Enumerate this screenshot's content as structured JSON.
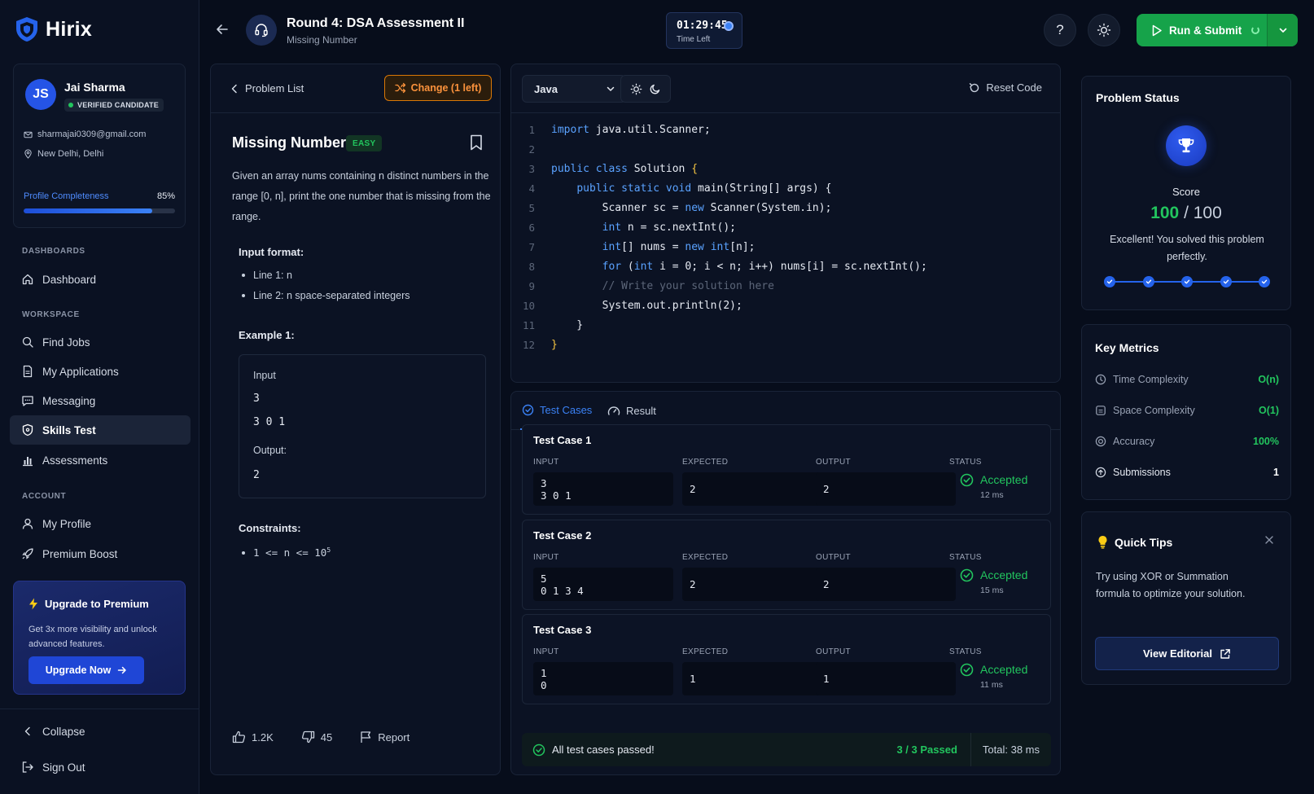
{
  "brand": {
    "name": "Hirix"
  },
  "profile": {
    "initials": "JS",
    "name": "Jai Sharma",
    "badge": "VERIFIED CANDIDATE",
    "email": "sharmajai0309@gmail.com",
    "location": "New Delhi, Delhi",
    "completeness_label": "Profile Completeness",
    "completeness_value": "85%",
    "completeness_fraction": 0.85
  },
  "nav": {
    "dashboards_label": "DASHBOARDS",
    "workspace_label": "WORKSPACE",
    "account_label": "ACCOUNT",
    "items": [
      {
        "label": "Dashboard",
        "icon": "home-icon"
      },
      {
        "label": "Find Jobs",
        "icon": "search-icon"
      },
      {
        "label": "My Applications",
        "icon": "document-icon"
      },
      {
        "label": "Messaging",
        "icon": "chat-icon"
      },
      {
        "label": "Skills Test",
        "icon": "shield-icon",
        "active": true
      },
      {
        "label": "Assessments",
        "icon": "bar-chart-icon"
      },
      {
        "label": "My Profile",
        "icon": "user-icon"
      },
      {
        "label": "Premium Boost",
        "icon": "rocket-icon"
      }
    ],
    "collapse": "Collapse",
    "sign_out": "Sign Out"
  },
  "promo": {
    "title": "Upgrade to Premium",
    "desc": "Get 3x more visibility and unlock advanced features.",
    "button": "Upgrade Now"
  },
  "header": {
    "title": "Round 4: DSA Assessment II",
    "subtitle": "Missing Number",
    "timer": "01:29:45",
    "timer_label": "Time Left",
    "help": "?",
    "run_submit": "Run & Submit"
  },
  "problem": {
    "back_label": "Problem List",
    "change_label": "Change (1 left)",
    "title": "Missing Number",
    "difficulty": "EASY",
    "description": "Given an array nums containing n distinct numbers in the range [0, n], print the one number that is missing from the range.",
    "input_format_heading": "Input format:",
    "input_format": [
      "Line 1: n",
      "Line 2: n space-separated integers"
    ],
    "example_heading": "Example 1:",
    "example": {
      "input_label": "Input",
      "input_line1": "3",
      "input_line2": "3 0 1",
      "output_label": "Output:",
      "output": "2"
    },
    "constraints_heading": "Constraints:",
    "constraint_prefix": "1 <= n <= 10",
    "constraint_exp": "5",
    "likes": "1.2K",
    "dislikes": "45",
    "report": "Report"
  },
  "editor": {
    "language": "Java",
    "reset": "Reset Code",
    "lines": [
      [
        [
          "kw",
          "import"
        ],
        [
          "t",
          " java.util.Scanner;"
        ]
      ],
      [],
      [
        [
          "kw",
          "public class"
        ],
        [
          "t",
          " Solution "
        ],
        [
          "br",
          "{"
        ]
      ],
      [
        [
          "t",
          "    "
        ],
        [
          "kw",
          "public static void"
        ],
        [
          "t",
          " main(String[] args) {"
        ]
      ],
      [
        [
          "t",
          "        Scanner sc = "
        ],
        [
          "kw",
          "new"
        ],
        [
          "t",
          " Scanner(System.in);"
        ]
      ],
      [
        [
          "t",
          "        "
        ],
        [
          "kw",
          "int"
        ],
        [
          "t",
          " n = sc.nextInt();"
        ]
      ],
      [
        [
          "t",
          "        "
        ],
        [
          "kw",
          "int"
        ],
        [
          "t",
          "[] nums = "
        ],
        [
          "kw",
          "new int"
        ],
        [
          "t",
          "[n];"
        ]
      ],
      [
        [
          "t",
          "        "
        ],
        [
          "kw",
          "for"
        ],
        [
          "t",
          " ("
        ],
        [
          "kw",
          "int"
        ],
        [
          "t",
          " i = 0; i < n; i++) nums[i] = sc.nextInt();"
        ]
      ],
      [
        [
          "t",
          "        "
        ],
        [
          "cm",
          "// Write your solution here"
        ]
      ],
      [
        [
          "t",
          "        System.out.println(2);"
        ]
      ],
      [
        [
          "t",
          "    }"
        ]
      ],
      [
        [
          "br",
          "}"
        ]
      ]
    ]
  },
  "tests": {
    "tab_cases": "Test Cases",
    "tab_result": "Result",
    "col_input": "INPUT",
    "col_expected": "EXPECTED",
    "col_output": "OUTPUT",
    "col_status": "STATUS",
    "cases": [
      {
        "title": "Test Case 1",
        "input1": "3",
        "input2": "3 0 1",
        "expected": "2",
        "output": "2",
        "status": "Accepted",
        "time": "12 ms"
      },
      {
        "title": "Test Case 2",
        "input1": "5",
        "input2": "0 1 3 4",
        "expected": "2",
        "output": "2",
        "status": "Accepted",
        "time": "15 ms"
      },
      {
        "title": "Test Case 3",
        "input1": "1",
        "input2": "0",
        "expected": "1",
        "output": "1",
        "status": "Accepted",
        "time": "11 ms"
      }
    ],
    "summary": "All test cases passed!",
    "passed": "3 / 3 Passed",
    "total": "Total: 38 ms"
  },
  "status": {
    "title": "Problem Status",
    "score_label": "Score",
    "score": "100",
    "score_max": "/ 100",
    "message": "Excellent! You solved this problem perfectly.",
    "steps_completed": 5
  },
  "metrics": {
    "title": "Key Metrics",
    "rows": [
      {
        "label": "Time Complexity",
        "value": "O(n)",
        "icon": "clock-icon"
      },
      {
        "label": "Space Complexity",
        "value": "O(1)",
        "icon": "storage-icon"
      },
      {
        "label": "Accuracy",
        "value": "100%",
        "icon": "target-icon"
      },
      {
        "label": "Submissions",
        "value": "1",
        "icon": "upload-icon"
      }
    ]
  },
  "tips": {
    "title": "Quick Tips",
    "body": "Try using XOR or Summation formula to optimize your solution.",
    "button": "View Editorial"
  },
  "colors": {
    "accent": "#3b82f6",
    "success": "#22c55e",
    "warning": "#fb923c",
    "background": "#070d1b"
  }
}
